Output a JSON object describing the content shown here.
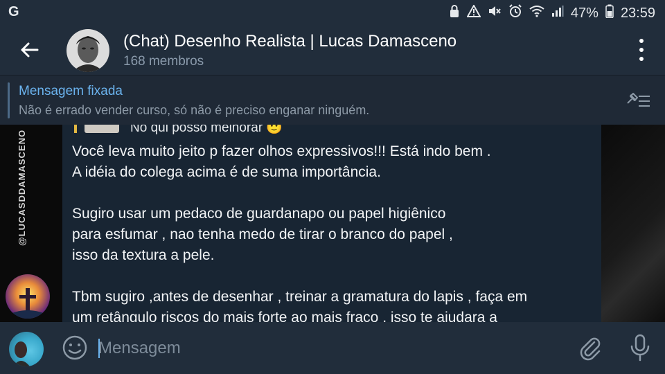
{
  "status_bar": {
    "carrier_icon": "G",
    "battery_percent": "47%",
    "time": "23:59",
    "icons": [
      "lock-icon",
      "warning-icon",
      "mute-icon",
      "alarm-icon",
      "wifi-icon",
      "signal-icon",
      "battery-icon"
    ]
  },
  "header": {
    "title": "(Chat) Desenho Realista | Lucas Damasceno",
    "members": "168 membros"
  },
  "pinned": {
    "title": "Mensagem fixada",
    "text": "Não é errado vender curso, só não é preciso enganar ninguém."
  },
  "chat": {
    "watermark": "@LUCASDDAMASCENO",
    "reply_preview": "No qui posso melhorar 🙂",
    "message": "Você leva muito jeito p fazer olhos expressivos!!! Está indo bem .\nA idéia do colega acima é de suma importância.\n\nSugiro usar um pedaco de guardanapo ou papel higiênico\npara esfumar , nao tenha medo de tirar o branco do papel ,\nisso da textura a pele.\n\nTbm sugiro ,antes de desenhar , treinar a gramatura do lapis , faça em\num retângulo riscos do mais forte ao mais fraco , isso te ajudara a"
  },
  "input": {
    "placeholder": "Mensagem"
  },
  "colors": {
    "header_bg": "#212d3b",
    "bubble_bg": "#182533",
    "accent": "#6bb3ee",
    "muted_text": "#8d9aa7"
  }
}
